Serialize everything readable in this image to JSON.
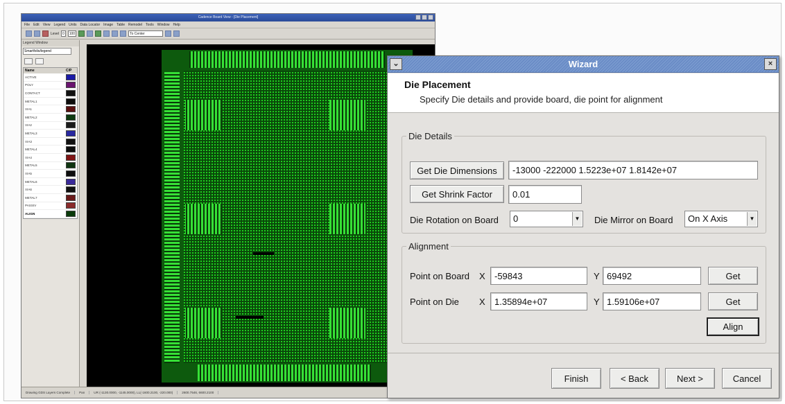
{
  "app": {
    "title": "Cadence Board View - [Die Placement]",
    "menu": [
      "File",
      "Edit",
      "View",
      "Legend",
      "Units",
      "Data Locator",
      "Image",
      "Table",
      "Remodel",
      "Tools",
      "Window",
      "Help"
    ],
    "toolbar": {
      "level_label": "Level",
      "level_value": "0",
      "zoom_value": "100",
      "center_combo": "To Center"
    },
    "legend": {
      "title": "Legend Window",
      "selector": "Smartfolio/legend",
      "col_name": "Name",
      "col_color": "C/P",
      "layers": [
        {
          "name": "ACTIVE",
          "color": "#1a1aa6"
        },
        {
          "name": "POLY",
          "color": "#6a1470"
        },
        {
          "name": "CONTACT",
          "color": "#111111"
        },
        {
          "name": "METAL1",
          "color": "#0d0d0d"
        },
        {
          "name": "VIA1",
          "color": "#5a1010"
        },
        {
          "name": "METAL2",
          "color": "#0d3a10"
        },
        {
          "name": "VIA2",
          "color": "#1a1a1a"
        },
        {
          "name": "METAL3",
          "color": "#2828a0"
        },
        {
          "name": "VIA3",
          "color": "#111111"
        },
        {
          "name": "METAL4",
          "color": "#0d0d0d"
        },
        {
          "name": "VIA4",
          "color": "#801414"
        },
        {
          "name": "METAL5",
          "color": "#0e3410"
        },
        {
          "name": "VIA5",
          "color": "#0d0d0d"
        },
        {
          "name": "METAL6",
          "color": "#3a2a9a"
        },
        {
          "name": "VIA6",
          "color": "#111111"
        },
        {
          "name": "METAL7",
          "color": "#6a1a1a"
        },
        {
          "name": "PASSIV",
          "color": "#8a2a2a"
        },
        {
          "name": "ALIGN",
          "color": "#0a3a0a"
        }
      ]
    },
    "status": [
      "Drawing GDS Layers Complete",
      "Pan",
      "UR (-1130.0000, -1145.0000), LL(-1600.2100, -220.000)",
      "2600.7546, 6600.2100"
    ]
  },
  "wizard": {
    "title": "Wizard",
    "header_title": "Die Placement",
    "header_subtitle": "Specify Die details and provide board, die point for alignment",
    "die_details": {
      "group_title": "Die Details",
      "get_dimensions_button": "Get Die Dimensions",
      "dimensions_value": "-13000 -222000 1.5223e+07 1.8142e+07",
      "get_shrink_button": "Get Shrink Factor",
      "shrink_value": "0.01",
      "rotation_label": "Die Rotation on Board",
      "rotation_value": "0",
      "mirror_label": "Die Mirror on Board",
      "mirror_value": "On X Axis"
    },
    "alignment": {
      "group_title": "Alignment",
      "board_label": "Point on Board",
      "board_x_label": "X",
      "board_x_value": "-59843",
      "board_y_label": "Y",
      "board_y_value": "69492",
      "board_get_button": "Get",
      "die_label": "Point on Die",
      "die_x_label": "X",
      "die_x_value": "1.35894e+07",
      "die_y_label": "Y",
      "die_y_value": "1.59106e+07",
      "die_get_button": "Get",
      "align_button": "Align"
    },
    "footer": {
      "finish": "Finish",
      "back": "< Back",
      "next": "Next >",
      "cancel": "Cancel"
    },
    "colors": {
      "title_bar": "#7f9fd2",
      "dialog_bg": "#e4e2df",
      "layout_green": "#1fcf1f"
    }
  }
}
